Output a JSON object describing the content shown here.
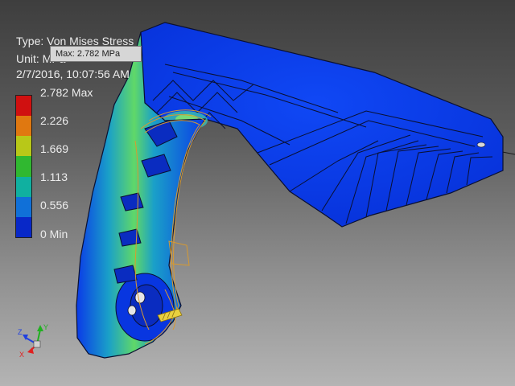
{
  "analysis": {
    "type_label": "Type: Von Mises Stress",
    "unit_label": "Unit: MPa",
    "datetime": "2/7/2016, 10:07:56 AM"
  },
  "tooltip": {
    "text": "Max: 2.782 MPa"
  },
  "legend": {
    "labels": [
      "2.782 Max",
      "2.226",
      "1.669",
      "1.113",
      "0.556",
      "0 Min"
    ],
    "colors": [
      "#d01010",
      "#e07810",
      "#b8c818",
      "#30b830",
      "#10b0a0",
      "#1070d8",
      "#0828c8"
    ]
  },
  "triad": {
    "x_label": "X",
    "y_label": "Y",
    "z_label": "Z",
    "x_color": "#e02020",
    "y_color": "#20b020",
    "z_color": "#2040e0"
  },
  "model": {
    "base_color": "#0a3ae8",
    "hot_color": "#50d070",
    "edge_color": "#0a1030",
    "wire_color": "#d89a30"
  }
}
